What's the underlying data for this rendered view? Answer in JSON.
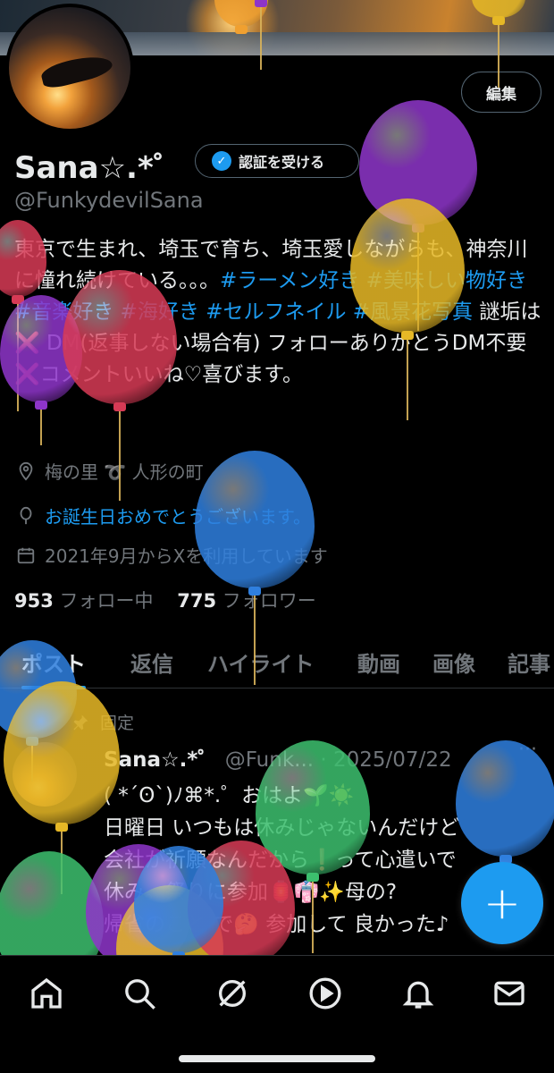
{
  "profile": {
    "edit_label": "編集",
    "name": "Sana☆.*゜",
    "verify_label": "認証を受ける",
    "handle": "@FunkydevilSana",
    "bio": [
      {
        "t": "東京で生まれ、埼玉で育ち、埼玉愛しながらも、神奈川に憧れ続けている。。。"
      },
      {
        "t": "#ラーメン好き",
        "tag": true
      },
      {
        "t": " "
      },
      {
        "t": "#美味しい物好き",
        "tag": true
      },
      {
        "t": " "
      },
      {
        "t": "#音楽好き",
        "tag": true
      },
      {
        "t": " "
      },
      {
        "t": "#海好き",
        "tag": true
      },
      {
        "t": " "
      },
      {
        "t": "#セルフネイル",
        "tag": true
      },
      {
        "t": " "
      },
      {
        "t": "#風景花写真",
        "tag": true
      },
      {
        "t": " 謎垢は"
      },
      {
        "t": "❌",
        "x": true
      },
      {
        "t": " DM(返事しない場合有) フォローありがとうDM不要"
      },
      {
        "t": "❌",
        "x": true
      },
      {
        "t": "コメントいいね♡喜びます。"
      }
    ],
    "location": "梅の里 ➰ 人形の町",
    "birthday": "お誕生日おめでとうございます。",
    "joined": "2021年9月からXを利用しています",
    "following_count": "953",
    "following_label": "フォロー中",
    "followers_count": "775",
    "followers_label": "フォロワー"
  },
  "tabs": [
    "ポスト",
    "返信",
    "ハイライト",
    "動画",
    "画像",
    "記事"
  ],
  "pinned_post": {
    "pinned_label": "固定",
    "author": "Sana☆.*゜",
    "handle": "@Funk...",
    "date": "2025/07/22",
    "more": "···",
    "lines": [
      "( *´ʘ`)ﾉ⌘*.゜おはよ🌱☀️",
      "日曜日 いつもは休みじゃないんだけど",
      "会社が祈願なんだから❗️って心遣いで",
      "休み。祭りに参加🏮👘✨母の?",
      "帰省のこと で🤔 参加して 良かった♪"
    ]
  },
  "fab_label": "+",
  "nav_icons": [
    "home-icon",
    "search-icon",
    "grok-icon",
    "video-icon",
    "notifications-icon",
    "messages-icon"
  ],
  "balloon_colors": {
    "purple": "#8e35c9",
    "yellow": "#e6b826",
    "red": "#d63a55",
    "blue": "#2f7fde",
    "green": "#3cbf6e",
    "orange": "#f0a030"
  }
}
